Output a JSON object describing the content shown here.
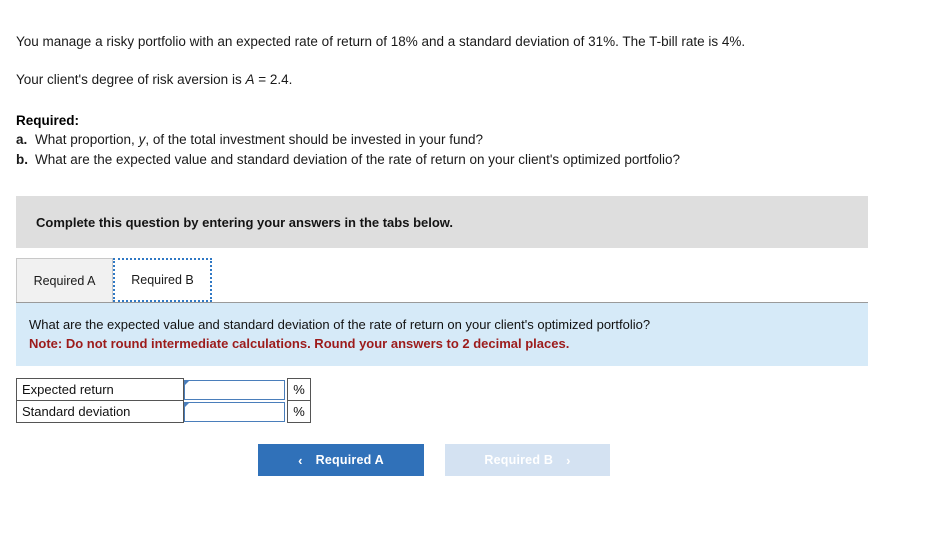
{
  "stem": {
    "paragraph_1": "You manage a risky portfolio with an expected rate of return of 18% and a standard deviation of 31%. The T-bill rate is 4%.",
    "paragraph_2_prefix": "Your client's degree of risk aversion is ",
    "paragraph_2_var": "A",
    "paragraph_2_suffix": " = 2.4."
  },
  "required": {
    "title": "Required:",
    "items": [
      {
        "letter": "a.",
        "text_before_var": "What proportion, ",
        "var": "y",
        "text_after_var": ", of the total investment should be invested in your fund?"
      },
      {
        "letter": "b.",
        "text_before_var": "What are the expected value and standard deviation of the rate of return on your client's optimized portfolio?",
        "var": "",
        "text_after_var": ""
      }
    ]
  },
  "banner": {
    "text": "Complete this question by entering your answers in the tabs below."
  },
  "tabs": [
    {
      "label": "Required A",
      "active": false
    },
    {
      "label": "Required B",
      "active": true
    }
  ],
  "question_panel": {
    "question": "What are the expected value and standard deviation of the rate of return on your client's optimized portfolio?",
    "note": "Note: Do not round intermediate calculations. Round your answers to 2 decimal places."
  },
  "answer_table": {
    "rows": [
      {
        "label": "Expected return",
        "value": "",
        "unit": "%"
      },
      {
        "label": "Standard deviation",
        "value": "",
        "unit": "%"
      }
    ]
  },
  "navigation": {
    "prev_label": "Required A",
    "prev_icon": "chevron-left-icon",
    "prev_glyph": "‹",
    "next_label": "Required B",
    "next_icon": "chevron-right-icon",
    "next_glyph": "›"
  },
  "colors": {
    "banner_gray": "#dedede",
    "panel_blue": "#d6eaf8",
    "note_red": "#9c1b1b",
    "button_blue": "#3071b9",
    "button_disabled_blue": "#d4e2f2",
    "input_border_blue": "#4a7ebb",
    "tab_focus_blue": "#2f78c4"
  }
}
